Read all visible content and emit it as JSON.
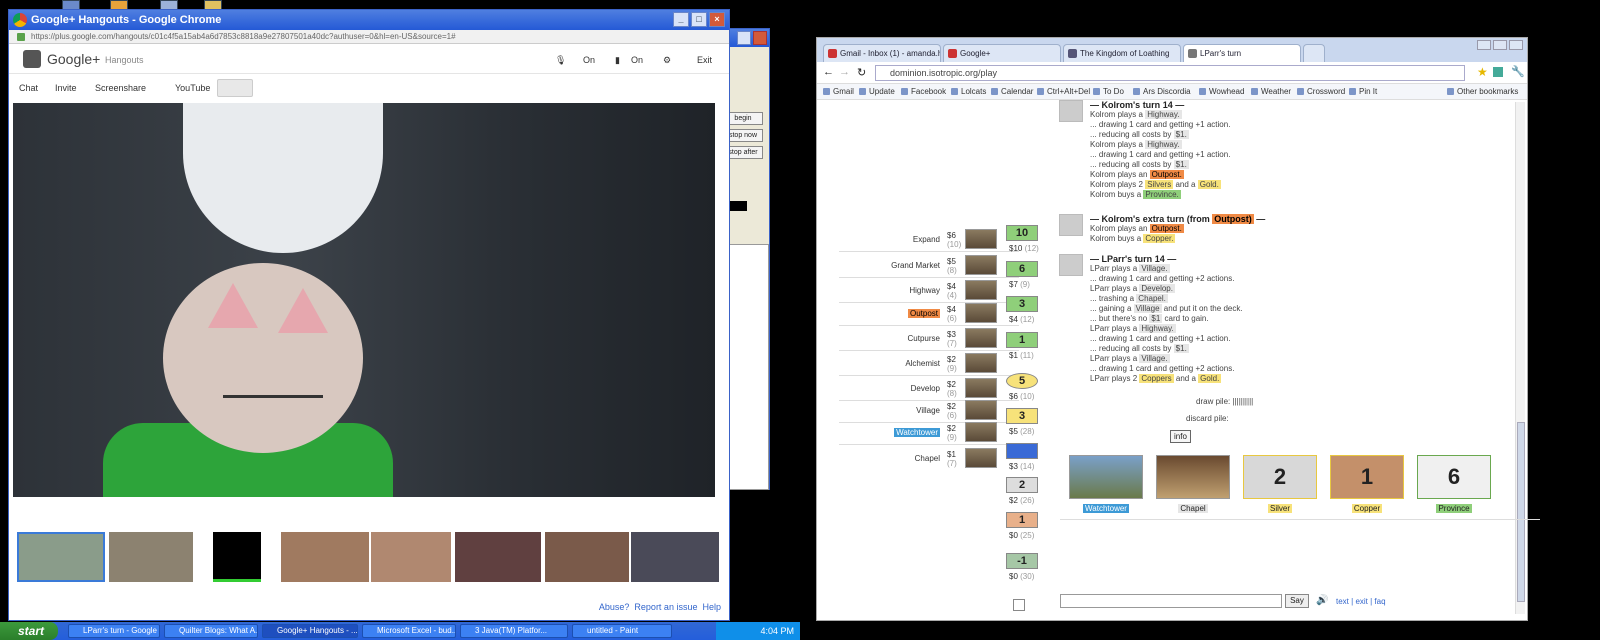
{
  "hangouts": {
    "window_title": "Google+ Hangouts - Google Chrome",
    "url": "https://plus.google.com/hangouts/c01c4f5a15ab4a6d7853c8818a9e27807501a40dc?authuser=0&hl=en-US&source=1#",
    "brand": "Google+",
    "product": "Hangouts",
    "mic_label": "On",
    "cam_label": "On",
    "exit_label": "Exit",
    "tabs": [
      "Chat",
      "Invite",
      "Screenshare",
      "YouTube"
    ],
    "footer": [
      "Abuse?",
      "Report an issue",
      "Help"
    ]
  },
  "java_window": {
    "buttons": [
      "begin",
      "stop now",
      "stop after"
    ]
  },
  "dominion": {
    "tabs": [
      "Gmail - Inbox (1) - amanda.hil...",
      "Google+",
      "The Kingdom of Loathing",
      "LParr's turn"
    ],
    "address": "dominion.isotropic.org/play",
    "bookmarks": [
      "Gmail",
      "Update",
      "Facebook",
      "Lolcats",
      "Calendar",
      "Ctrl+Alt+Del",
      "To Do",
      "Ars Discordia",
      "Wowhead",
      "Weather",
      "Crossword",
      "Pin It"
    ],
    "other_bookmarks": "Other bookmarks",
    "supply": [
      {
        "name": "Expand",
        "cost": "$6",
        "count": "(10)"
      },
      {
        "name": "Grand Market",
        "cost": "$5",
        "count": "(8)"
      },
      {
        "name": "Highway",
        "cost": "$4",
        "count": "(4)"
      },
      {
        "name": "Outpost",
        "cost": "$4",
        "count": "(6)"
      },
      {
        "name": "Cutpurse",
        "cost": "$3",
        "count": "(7)"
      },
      {
        "name": "Alchemist",
        "cost": "$2",
        "count": "(9)"
      },
      {
        "name": "Develop",
        "cost": "$2",
        "count": "(8)"
      },
      {
        "name": "Village",
        "cost": "$2",
        "count": "(6)"
      },
      {
        "name": "Watchtower",
        "cost": "$2",
        "count": "(9)"
      },
      {
        "name": "Chapel",
        "cost": "$1",
        "count": "(7)"
      }
    ],
    "base": [
      {
        "label": "10",
        "cost": "$10",
        "count": "(12)"
      },
      {
        "label": "6",
        "cost": "$7",
        "count": "(9)"
      },
      {
        "label": "3",
        "cost": "$4",
        "count": "(12)"
      },
      {
        "label": "1",
        "cost": "$1",
        "count": "(11)"
      },
      {
        "label": "5",
        "cost": "$6",
        "count": "(10)"
      },
      {
        "label": "3",
        "cost": "$5",
        "count": "(28)"
      },
      {
        "label": "",
        "cost": "$3",
        "count": "(14)"
      },
      {
        "label": "2",
        "cost": "$2",
        "count": "(26)"
      },
      {
        "label": "1",
        "cost": "$0",
        "count": "(25)"
      },
      {
        "label": "-1",
        "cost": "$0",
        "count": "(30)"
      }
    ],
    "log_top": [
      "— Kolrom's turn 14 —",
      "Kolrom plays a Highway.",
      "... drawing 1 card and getting +1 action.",
      "... reducing all costs by $1.",
      "Kolrom plays a Highway.",
      "... drawing 1 card and getting +1 action.",
      "... reducing all costs by $1.",
      "Kolrom plays an Outpost.",
      "Kolrom plays 2 Silvers and a Gold.",
      "Kolrom buys a Province."
    ],
    "log_extra_head": "— Kolrom's extra turn (from Outpost) —",
    "log_extra": [
      "Kolrom plays an Outpost.",
      "Kolrom buys a Copper."
    ],
    "log_lparr_head": "— LParr's turn 14 —",
    "log_lparr": [
      "LParr plays a Village.",
      "... drawing 1 card and getting +2 actions.",
      "LParr plays a Develop.",
      "... trashing a Chapel.",
      "... gaining a Village and put it on the deck.",
      "... but there's no $1 card to gain.",
      "LParr plays a Highway.",
      "... drawing 1 card and getting +1 action.",
      "... reducing all costs by $1.",
      "LParr plays a Village.",
      "... drawing 1 card and getting +2 actions.",
      "LParr plays 2 Coppers and a Gold."
    ],
    "draw_pile": "draw pile: ||||||||||",
    "discard_pile": "discard pile:",
    "info_button": "info",
    "hand": [
      "Watchtower",
      "Chapel",
      "Silver",
      "Copper",
      "Province"
    ],
    "hand_card_text": [
      "",
      "",
      "2",
      "1",
      "6"
    ],
    "say_button": "Say",
    "links": [
      "text",
      "exit",
      "faq"
    ]
  },
  "taskbar": {
    "start": "start",
    "items": [
      "LParr's turn - Google ...",
      "Quilter Blogs: What A...",
      "Google+ Hangouts - ...",
      "Microsoft Excel - bud...",
      "3 Java(TM) Platfor...",
      "untitled - Paint"
    ],
    "clock": "4:04 PM"
  }
}
